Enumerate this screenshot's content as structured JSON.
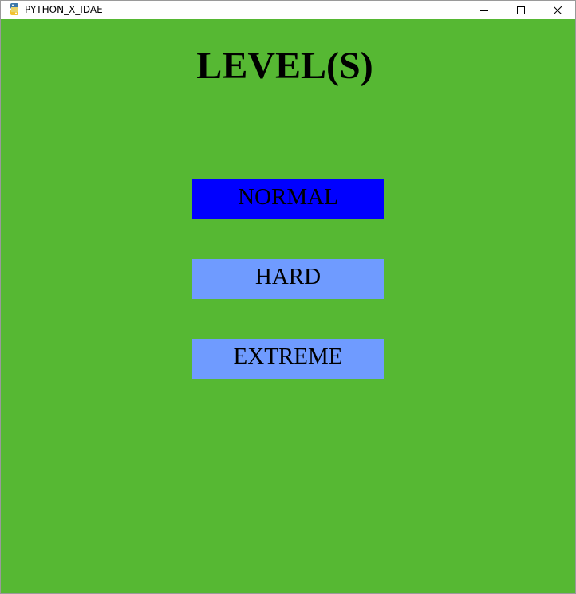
{
  "window": {
    "title": "PYTHON_X_IDAE",
    "icon": "python-icon",
    "controls": {
      "minimize_icon": "minimize-icon",
      "maximize_icon": "maximize-icon",
      "close_icon": "close-icon"
    }
  },
  "screen": {
    "title": "LEVEL(S)",
    "background_color": "#56b833",
    "levels": [
      {
        "label": "NORMAL",
        "selected": true,
        "color": "#0000ff"
      },
      {
        "label": "HARD",
        "selected": false,
        "color": "#6f9bff"
      },
      {
        "label": "EXTREME",
        "selected": false,
        "color": "#6f9bff"
      }
    ]
  }
}
